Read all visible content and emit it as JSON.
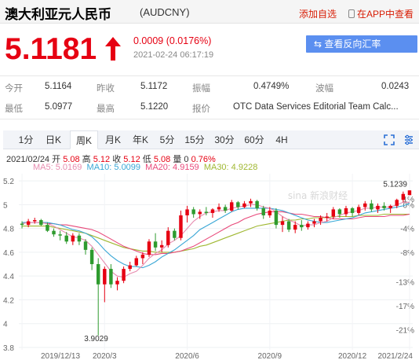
{
  "header": {
    "title": "澳大利亚元人民币",
    "code": "(AUDCNY)",
    "add_watchlist": "添加自选",
    "open_in_app": "在APP中查看"
  },
  "quote": {
    "price": "5.1181",
    "change": "0.0009 (0.0176%)",
    "time": "2021-02-24 06:17:19",
    "reverse_rate_button": "查看反向汇率"
  },
  "stats": [
    {
      "label": "今开",
      "value": "5.1164"
    },
    {
      "label": "昨收",
      "value": "5.1172"
    },
    {
      "label": "振幅",
      "value": "0.4749%"
    },
    {
      "label": "波幅",
      "value": "0.0243"
    },
    {
      "label": "最低",
      "value": "5.0977"
    },
    {
      "label": "最高",
      "value": "5.1220"
    },
    {
      "label": "报价",
      "value": "OTC Data Services Editorial Team Calc..."
    }
  ],
  "tabs": [
    "1分",
    "日K",
    "周K",
    "月K",
    "年K",
    "5分",
    "15分",
    "30分",
    "60分",
    "4H"
  ],
  "active_tab": "周K",
  "ohlc": {
    "date": "2021/02/24",
    "open_label": "开",
    "open": "5.08",
    "high_label": "高",
    "high": "5.12",
    "close_label": "收",
    "close": "5.12",
    "low_label": "低",
    "low": "5.08",
    "vol_label": "量",
    "vol": "0",
    "pct": "0.76%"
  },
  "ma": [
    {
      "label": "MA5:",
      "value": "5.0169",
      "color": "#e78db0"
    },
    {
      "label": "MA10:",
      "value": "5.0099",
      "color": "#3aa7d6"
    },
    {
      "label": "MA20:",
      "value": "4.9159",
      "color": "#e8497a"
    },
    {
      "label": "MA30:",
      "value": "4.9228",
      "color": "#a0b832"
    }
  ],
  "colors": {
    "up": "#e60012",
    "down": "#2e9b2e",
    "accent": "#5b8ff0"
  },
  "chart_data": {
    "type": "candlestick",
    "y_ticks": [
      "5.2",
      "5",
      "4.8",
      "4.6",
      "4.4",
      "4.2",
      "4",
      "3.8"
    ],
    "y_tick_values": [
      5.2,
      5.0,
      4.8,
      4.6,
      4.4,
      4.2,
      4.0,
      3.8
    ],
    "pct_ticks": [
      "1%",
      "0%",
      "-4%",
      "-8%",
      "-13%",
      "-17%",
      "-21%"
    ],
    "pct_tick_values": [
      1,
      0,
      -4,
      -8,
      -13,
      -17,
      -21
    ],
    "ylim": [
      3.78,
      5.26
    ],
    "x_labels": [
      "2019/12/13",
      "2020/3",
      "2020/6",
      "2020/9",
      "2020/12",
      "2021/2/24"
    ],
    "x_label_index": [
      0,
      13,
      26,
      39,
      52,
      61
    ],
    "max_label": "5.1239",
    "min_label": "3.9029",
    "watermark": "sina 新浪财经",
    "candles": [
      [
        4.84,
        4.86,
        4.8,
        4.83
      ],
      [
        4.83,
        4.88,
        4.81,
        4.86
      ],
      [
        4.86,
        4.89,
        4.84,
        4.87
      ],
      [
        4.87,
        4.88,
        4.82,
        4.83
      ],
      [
        4.83,
        4.85,
        4.77,
        4.78
      ],
      [
        4.78,
        4.8,
        4.73,
        4.75
      ],
      [
        4.75,
        4.78,
        4.7,
        4.74
      ],
      [
        4.74,
        4.77,
        4.67,
        4.69
      ],
      [
        4.69,
        4.76,
        4.66,
        4.74
      ],
      [
        4.74,
        4.76,
        4.66,
        4.69
      ],
      [
        4.69,
        4.71,
        4.58,
        4.62
      ],
      [
        4.62,
        4.64,
        4.45,
        4.5
      ],
      [
        4.5,
        4.55,
        3.9,
        4.33
      ],
      [
        4.33,
        4.48,
        4.18,
        4.46
      ],
      [
        4.46,
        4.5,
        4.3,
        4.33
      ],
      [
        4.33,
        4.39,
        4.28,
        4.36
      ],
      [
        4.36,
        4.48,
        4.34,
        4.46
      ],
      [
        4.46,
        4.52,
        4.44,
        4.49
      ],
      [
        4.49,
        4.57,
        4.48,
        4.55
      ],
      [
        4.55,
        4.6,
        4.5,
        4.58
      ],
      [
        4.58,
        4.71,
        4.56,
        4.69
      ],
      [
        4.69,
        4.76,
        4.61,
        4.64
      ],
      [
        4.64,
        4.7,
        4.6,
        4.66
      ],
      [
        4.66,
        4.81,
        4.64,
        4.78
      ],
      [
        4.78,
        4.8,
        4.7,
        4.72
      ],
      [
        4.72,
        4.95,
        4.7,
        4.91
      ],
      [
        4.91,
        4.99,
        4.85,
        4.96
      ],
      [
        4.96,
        4.98,
        4.89,
        4.92
      ],
      [
        4.92,
        4.96,
        4.88,
        4.94
      ],
      [
        4.94,
        4.98,
        4.91,
        4.93
      ],
      [
        4.93,
        4.97,
        4.89,
        4.96
      ],
      [
        4.96,
        5.01,
        4.94,
        4.98
      ],
      [
        4.98,
        5.0,
        4.93,
        4.95
      ],
      [
        4.95,
        5.04,
        4.94,
        5.02
      ],
      [
        5.02,
        5.03,
        4.96,
        4.98
      ],
      [
        4.98,
        5.03,
        4.97,
        5.01
      ],
      [
        5.01,
        5.05,
        4.98,
        5.03
      ],
      [
        5.03,
        5.04,
        4.95,
        4.97
      ],
      [
        4.97,
        4.99,
        4.88,
        4.91
      ],
      [
        4.91,
        4.98,
        4.89,
        4.95
      ],
      [
        4.95,
        4.97,
        4.8,
        4.83
      ],
      [
        4.83,
        4.9,
        4.77,
        4.86
      ],
      [
        4.86,
        4.88,
        4.77,
        4.79
      ],
      [
        4.79,
        4.86,
        4.76,
        4.83
      ],
      [
        4.83,
        4.87,
        4.78,
        4.81
      ],
      [
        4.81,
        4.86,
        4.79,
        4.84
      ],
      [
        4.84,
        4.88,
        4.81,
        4.86
      ],
      [
        4.86,
        4.91,
        4.83,
        4.89
      ],
      [
        4.89,
        4.93,
        4.86,
        4.9
      ],
      [
        4.9,
        4.98,
        4.88,
        4.96
      ],
      [
        4.96,
        4.97,
        4.89,
        4.92
      ],
      [
        4.92,
        4.99,
        4.9,
        4.97
      ],
      [
        4.97,
        4.98,
        4.9,
        4.93
      ],
      [
        4.93,
        5.0,
        4.91,
        4.98
      ],
      [
        4.98,
        5.03,
        4.95,
        5.01
      ],
      [
        5.01,
        5.04,
        4.94,
        4.96
      ],
      [
        4.96,
        5.01,
        4.93,
        4.99
      ],
      [
        4.99,
        5.02,
        4.95,
        4.97
      ],
      [
        4.97,
        5.0,
        4.93,
        4.99
      ],
      [
        4.99,
        5.05,
        4.97,
        5.04
      ],
      [
        5.04,
        5.11,
        5.02,
        5.09
      ],
      [
        5.08,
        5.12,
        5.08,
        5.12
      ]
    ],
    "ma5": [
      4.84,
      4.85,
      4.85,
      4.85,
      4.84,
      4.82,
      4.79,
      4.76,
      4.73,
      4.72,
      4.7,
      4.65,
      4.58,
      4.51,
      4.44,
      4.4,
      4.39,
      4.42,
      4.44,
      4.49,
      4.55,
      4.59,
      4.62,
      4.67,
      4.7,
      4.74,
      4.8,
      4.86,
      4.9,
      4.93,
      4.94,
      4.95,
      4.95,
      4.97,
      4.98,
      4.99,
      5.0,
      5.0,
      4.98,
      4.97,
      4.94,
      4.9,
      4.87,
      4.85,
      4.82,
      4.83,
      4.83,
      4.85,
      4.86,
      4.89,
      4.91,
      4.93,
      4.94,
      4.95,
      4.97,
      4.97,
      4.98,
      4.98,
      4.98,
      5.0,
      5.02,
      5.02
    ],
    "ma10": [
      4.85,
      4.85,
      4.85,
      4.85,
      4.85,
      4.84,
      4.83,
      4.81,
      4.79,
      4.78,
      4.76,
      4.73,
      4.68,
      4.62,
      4.57,
      4.53,
      4.5,
      4.48,
      4.48,
      4.47,
      4.49,
      4.52,
      4.56,
      4.59,
      4.62,
      4.66,
      4.7,
      4.74,
      4.79,
      4.82,
      4.85,
      4.88,
      4.91,
      4.94,
      4.96,
      4.97,
      4.97,
      4.97,
      4.97,
      4.97,
      4.96,
      4.95,
      4.93,
      4.91,
      4.89,
      4.87,
      4.86,
      4.85,
      4.85,
      4.86,
      4.87,
      4.88,
      4.89,
      4.91,
      4.93,
      4.94,
      4.95,
      4.96,
      4.97,
      4.98,
      4.99,
      5.01
    ],
    "ma20": [
      4.85,
      4.85,
      4.85,
      4.85,
      4.84,
      4.84,
      4.83,
      4.83,
      4.82,
      4.81,
      4.8,
      4.79,
      4.77,
      4.74,
      4.71,
      4.68,
      4.65,
      4.63,
      4.61,
      4.59,
      4.58,
      4.58,
      4.59,
      4.59,
      4.6,
      4.61,
      4.63,
      4.65,
      4.68,
      4.71,
      4.74,
      4.77,
      4.8,
      4.83,
      4.85,
      4.88,
      4.9,
      4.92,
      4.93,
      4.94,
      4.94,
      4.94,
      4.93,
      4.92,
      4.92,
      4.91,
      4.9,
      4.9,
      4.89,
      4.88,
      4.88,
      4.88,
      4.88,
      4.89,
      4.9,
      4.9,
      4.9,
      4.9,
      4.91,
      4.91,
      4.91,
      4.92
    ],
    "ma30": [
      4.82,
      4.82,
      4.82,
      4.82,
      4.82,
      4.81,
      4.8,
      4.79,
      4.78,
      4.77,
      4.76,
      4.74,
      4.72,
      4.7,
      4.68,
      4.66,
      4.64,
      4.63,
      4.62,
      4.61,
      4.61,
      4.6,
      4.6,
      4.6,
      4.6,
      4.61,
      4.62,
      4.63,
      4.65,
      4.66,
      4.68,
      4.7,
      4.72,
      4.74,
      4.76,
      4.78,
      4.8,
      4.82,
      4.83,
      4.84,
      4.85,
      4.86,
      4.87,
      4.87,
      4.88,
      4.88,
      4.89,
      4.89,
      4.89,
      4.9,
      4.9,
      4.9,
      4.9,
      4.91,
      4.91,
      4.91,
      4.91,
      4.92,
      4.92,
      4.92,
      4.92,
      4.92
    ]
  }
}
